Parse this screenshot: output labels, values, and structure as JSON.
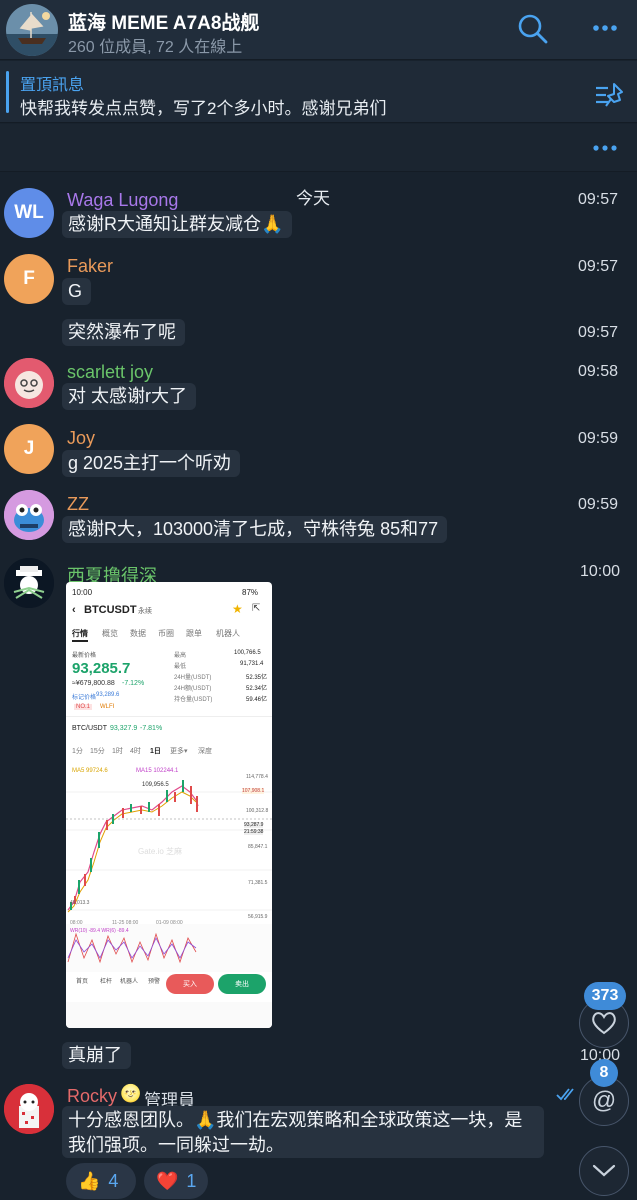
{
  "header": {
    "title": "蓝海 MEME A7A8战舰",
    "subtitle": "260 位成員, 72 人在線上"
  },
  "pinned": {
    "title": "置頂訊息",
    "text": "快帮我转发点点赞，写了2个多小时。感谢兄弟们"
  },
  "date_label": "今天",
  "messages": [
    {
      "avatar_text": "WL",
      "avatar_color": "#5f8de8",
      "name": "Waga Lugong",
      "name_color": "#a878ea",
      "text": "感谢R大通知让群友减仓🙏",
      "time": "09:57"
    },
    {
      "avatar_text": "F",
      "avatar_color": "#f0a35a",
      "name": "Faker",
      "name_color": "#e99a5a",
      "text": "G",
      "time": "09:57"
    },
    {
      "text": "突然瀑布了呢",
      "time": "09:57"
    },
    {
      "name": "scarlett joy",
      "name_color": "#6ac46a",
      "text": "对 太感谢r大了",
      "time": "09:58"
    },
    {
      "avatar_text": "J",
      "avatar_color": "#f0a35a",
      "name": "Joy",
      "name_color": "#e99a5a",
      "text": "g 2025主打一个听劝",
      "time": "09:59"
    },
    {
      "name": "ZZ",
      "name_color": "#e99a5a",
      "text": "感谢R大，103000清了七成，守株待兔 85和77",
      "time": "09:59"
    },
    {
      "name": "西夏撸得深",
      "name_color": "#6ac46a",
      "time": "10:00",
      "caption": "真崩了",
      "caption_time": "10:00"
    },
    {
      "name": "Rocky",
      "name_color": "#e46a6a",
      "role": "管理員",
      "text": "十分感恩团队。🙏我们在宏观策略和全球政策这一块，是我们强项。一同躲过一劫。"
    }
  ],
  "screenshot": {
    "status_time": "10:00",
    "status_battery": "87%",
    "pair": "BTCUSDT",
    "pair_suffix": "永续",
    "tabs": [
      "行情",
      "概览",
      "数据",
      "币圈",
      "跟单",
      "机器人"
    ],
    "latest_label": "最新价格",
    "price": "93,285.7",
    "cny": "≈¥679,800.88",
    "change": "-7.12%",
    "mark_label": "标记价格",
    "mark_value": "93,289.6",
    "stats": [
      {
        "label": "最高",
        "value": "100,766.5"
      },
      {
        "label": "最低",
        "value": "91,731.4"
      },
      {
        "label": "24H量(USDT)",
        "value": "52.35亿"
      },
      {
        "label": "24H额(USDT)",
        "value": "52.34亿"
      },
      {
        "label": "持仓量(USDT)",
        "value": "59.46亿"
      }
    ],
    "tags": [
      "NO.1",
      "WLFI"
    ],
    "sub_pair": "BTC/USDT",
    "sub_price": "93,327.9",
    "sub_change": "-7.81%",
    "intervals": [
      "1分",
      "15分",
      "1时",
      "4时",
      "1日",
      "更多▾",
      "深度"
    ],
    "ma_label": "MA5 99724.6",
    "ma15_label": "MA15 102244.1",
    "peak_label": "109,956.5",
    "axis_labels": [
      "114,778.4",
      "107,908.1",
      "100,312.8",
      "93,287.9",
      "21:59:38",
      "85,847.1",
      "71,381.5",
      "56,915.9"
    ],
    "low_label": "49,013.3",
    "date_labels": [
      "08:00",
      "11-25 08:00",
      "01-09 08:00"
    ],
    "wr_label": "WR(10) -89.4  WR(6) -89.4",
    "watermark": "Gate.io 芝麻",
    "bottom_tabs": [
      "首页",
      "杠杆",
      "机器人",
      "预警"
    ],
    "buy": "买入",
    "sell": "卖出"
  },
  "reactions": [
    {
      "emoji": "👍",
      "count": "4"
    },
    {
      "emoji": "❤️",
      "count": "1"
    }
  ],
  "fab": {
    "likes_badge": "373",
    "mention_badge": "8"
  }
}
